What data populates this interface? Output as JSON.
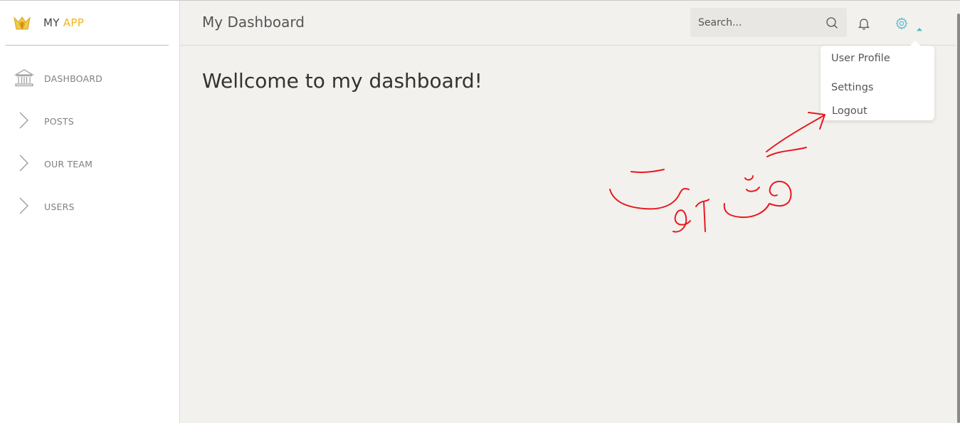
{
  "app": {
    "name_prefix": "MY",
    "name_accent": "APP",
    "accent_color": "#f2b51b"
  },
  "sidebar": {
    "items": [
      {
        "label": "DASHBOARD",
        "icon": "bank-icon"
      },
      {
        "label": "POSTS",
        "icon": "chevron-right-icon"
      },
      {
        "label": "OUR TEAM",
        "icon": "chevron-right-icon"
      },
      {
        "label": "USERS",
        "icon": "chevron-right-icon"
      }
    ]
  },
  "header": {
    "title": "My Dashboard",
    "search_placeholder": "Search...",
    "icons": [
      "search-icon",
      "bell-icon",
      "gear-icon",
      "caret-up-icon"
    ],
    "gear_color": "#4fb9c9"
  },
  "main": {
    "welcome": "Wellcome to my dashboard!"
  },
  "user_menu": {
    "items": [
      "User Profile",
      "Settings",
      "Logout"
    ]
  },
  "annotation": {
    "color": "#e8191f",
    "text": "لاگ اوت"
  }
}
